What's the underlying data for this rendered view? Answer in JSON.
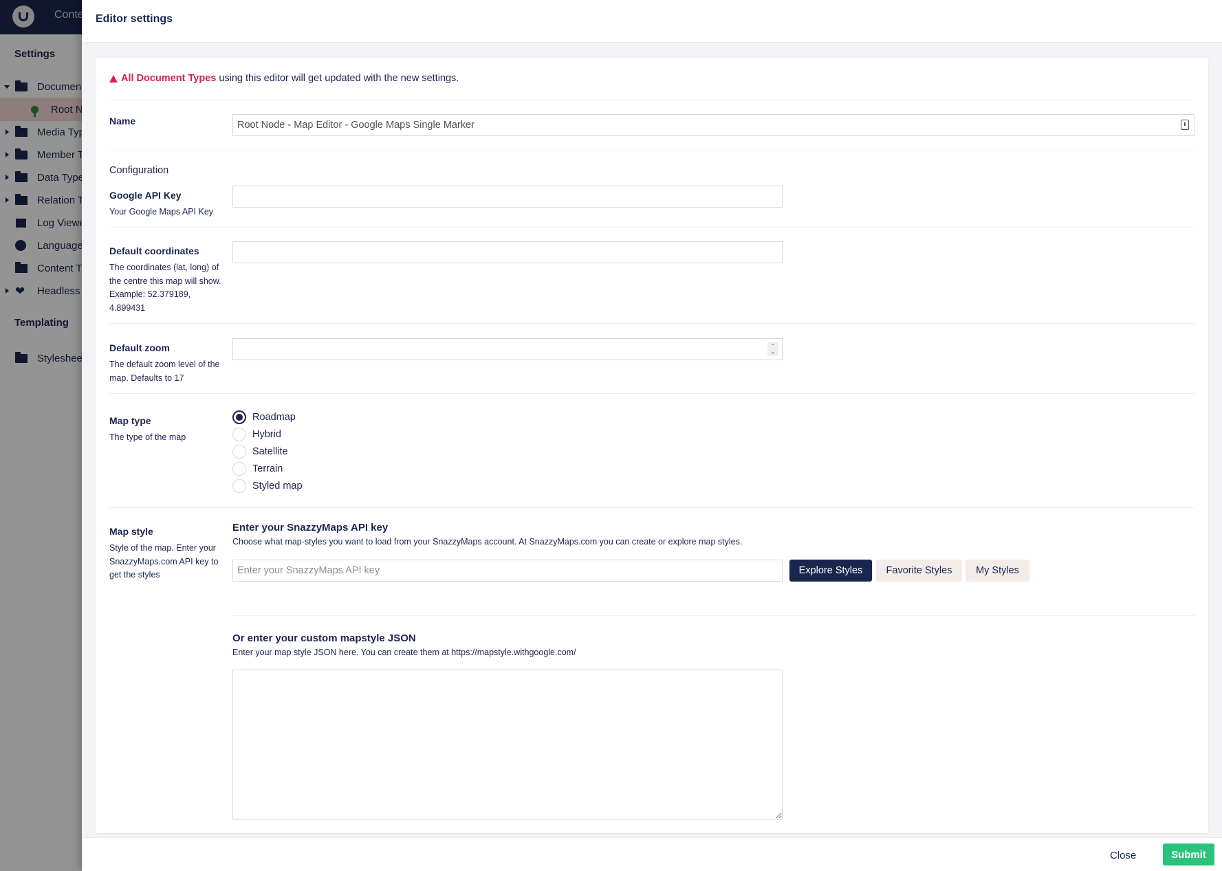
{
  "app": {
    "topbar_section": "Conte",
    "sidebar": {
      "settings_title": "Settings",
      "templating_title": "Templating",
      "items": [
        {
          "label": "Document",
          "icon": "folder-icon",
          "expanded": true
        },
        {
          "label": "Root N",
          "icon": "root-node-icon",
          "selected": true
        },
        {
          "label": "Media Typ",
          "icon": "folder-icon"
        },
        {
          "label": "Member T",
          "icon": "folder-icon"
        },
        {
          "label": "Data Type",
          "icon": "folder-icon"
        },
        {
          "label": "Relation T",
          "icon": "folder-icon"
        },
        {
          "label": "Log Viewe",
          "icon": "archive-icon"
        },
        {
          "label": "Languages",
          "icon": "globe-icon"
        },
        {
          "label": "Content T",
          "icon": "folder-icon"
        },
        {
          "label": "Headless",
          "icon": "heart-icon"
        },
        {
          "label": "Stylesheet",
          "icon": "folder-icon"
        }
      ]
    }
  },
  "editor": {
    "title": "Editor settings",
    "warning": {
      "link": "All Document Types",
      "text": "using this editor will get updated with the new settings."
    },
    "name": {
      "label": "Name",
      "value": "Root Node - Map Editor - Google Maps Single Marker"
    },
    "configuration_heading": "Configuration",
    "google_api_key": {
      "label": "Google API Key",
      "description": "Your Google Maps API Key",
      "value": ""
    },
    "default_coordinates": {
      "label": "Default coordinates",
      "description": "The coordinates (lat, long) of the centre this map will show. Example: 52.379189, 4.899431",
      "value": ""
    },
    "default_zoom": {
      "label": "Default zoom",
      "description": "The default zoom level of the map. Defaults to 17",
      "value": ""
    },
    "map_type": {
      "label": "Map type",
      "description": "The type of the map",
      "options": [
        "Roadmap",
        "Hybrid",
        "Satellite",
        "Terrain",
        "Styled map"
      ],
      "selected": "Roadmap"
    },
    "map_style": {
      "label": "Map style",
      "description": "Style of the map. Enter your SnazzyMaps.com API key to get the styles",
      "snazzy_title": "Enter your SnazzyMaps API key",
      "snazzy_desc": "Choose what map-styles you want to load from your SnazzyMaps account. At SnazzyMaps.com you can create or explore map styles.",
      "snazzy_placeholder": "Enter your SnazzyMaps API key",
      "buttons": {
        "explore": "Explore Styles",
        "favorite": "Favorite Styles",
        "mine": "My Styles"
      },
      "json_title": "Or enter your custom mapstyle JSON",
      "json_desc": "Enter your map style JSON here. You can create them at https://mapstyle.withgoogle.com/"
    },
    "footer": {
      "close": "Close",
      "submit": "Submit"
    }
  },
  "colors": {
    "primary": "#1b264f",
    "accent_warning": "#d42054",
    "submit": "#2bc37c",
    "secondary_button": "#f3ece9"
  }
}
